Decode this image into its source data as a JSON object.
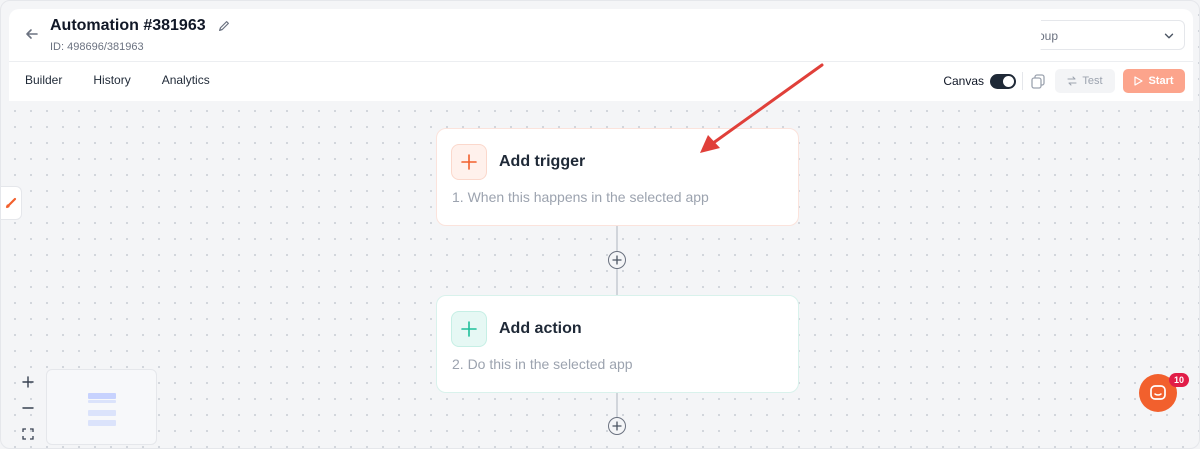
{
  "header": {
    "title": "Automation #381963",
    "subtitle": "ID: 498696/381963",
    "select_value": "oup",
    "tabs": [
      {
        "label": "Builder"
      },
      {
        "label": "History"
      },
      {
        "label": "Analytics"
      }
    ],
    "canvas_label": "Canvas",
    "test_label": "Test",
    "start_label": "Start"
  },
  "flow": {
    "trigger": {
      "title": "Add trigger",
      "description": "1. When this happens in the selected app"
    },
    "action": {
      "title": "Add action",
      "description": "2. Do this in the selected app"
    }
  },
  "chat": {
    "badge": "10"
  },
  "colors": {
    "accent": "#f2602d",
    "start_button": "#fca48c",
    "trigger_plus": "#f2602d",
    "action_plus": "#1fbf9a",
    "annotation_arrow": "#e0403a"
  }
}
